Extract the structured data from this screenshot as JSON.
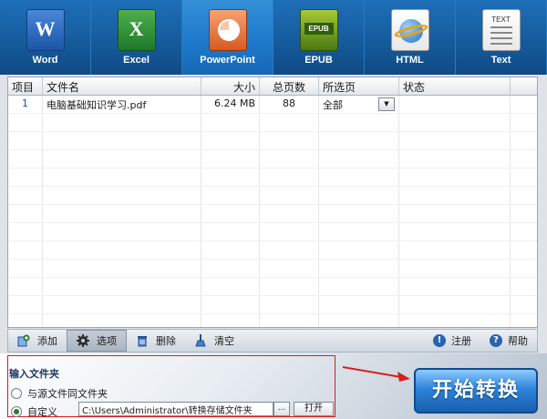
{
  "formats": [
    {
      "id": "word",
      "label": "Word",
      "glyph": "W"
    },
    {
      "id": "excel",
      "label": "Excel",
      "glyph": "X"
    },
    {
      "id": "powerpoint",
      "label": "PowerPoint",
      "glyph": ""
    },
    {
      "id": "epub",
      "label": "EPUB",
      "glyph": "EPUB"
    },
    {
      "id": "html",
      "label": "HTML",
      "glyph": ""
    },
    {
      "id": "text",
      "label": "Text",
      "glyph": "TEXT"
    }
  ],
  "active_format": "PowerPoint",
  "table": {
    "headers": [
      "项目",
      "文件名",
      "大小",
      "总页数",
      "所选页",
      "状态"
    ],
    "rows": [
      {
        "index": "1",
        "filename": "电脑基础知识学习.pdf",
        "size": "6.24 MB",
        "pages": "88",
        "selection": "全部",
        "status": ""
      }
    ]
  },
  "toolbar": {
    "add": "添加",
    "options": "选项",
    "delete": "删除",
    "clear": "清空",
    "register": "注册",
    "help": "帮助"
  },
  "output": {
    "title": "输入文件夹",
    "option_same": "与源文件同文件夹",
    "option_custom": "自定义",
    "path": "C:\\Users\\Administrator\\转换存储文件夹",
    "browse_label": "...",
    "open_label": "打开"
  },
  "start_button": "开始转换",
  "colors": {
    "accent": "#1f7acb",
    "annotation": "#d81e1e"
  }
}
